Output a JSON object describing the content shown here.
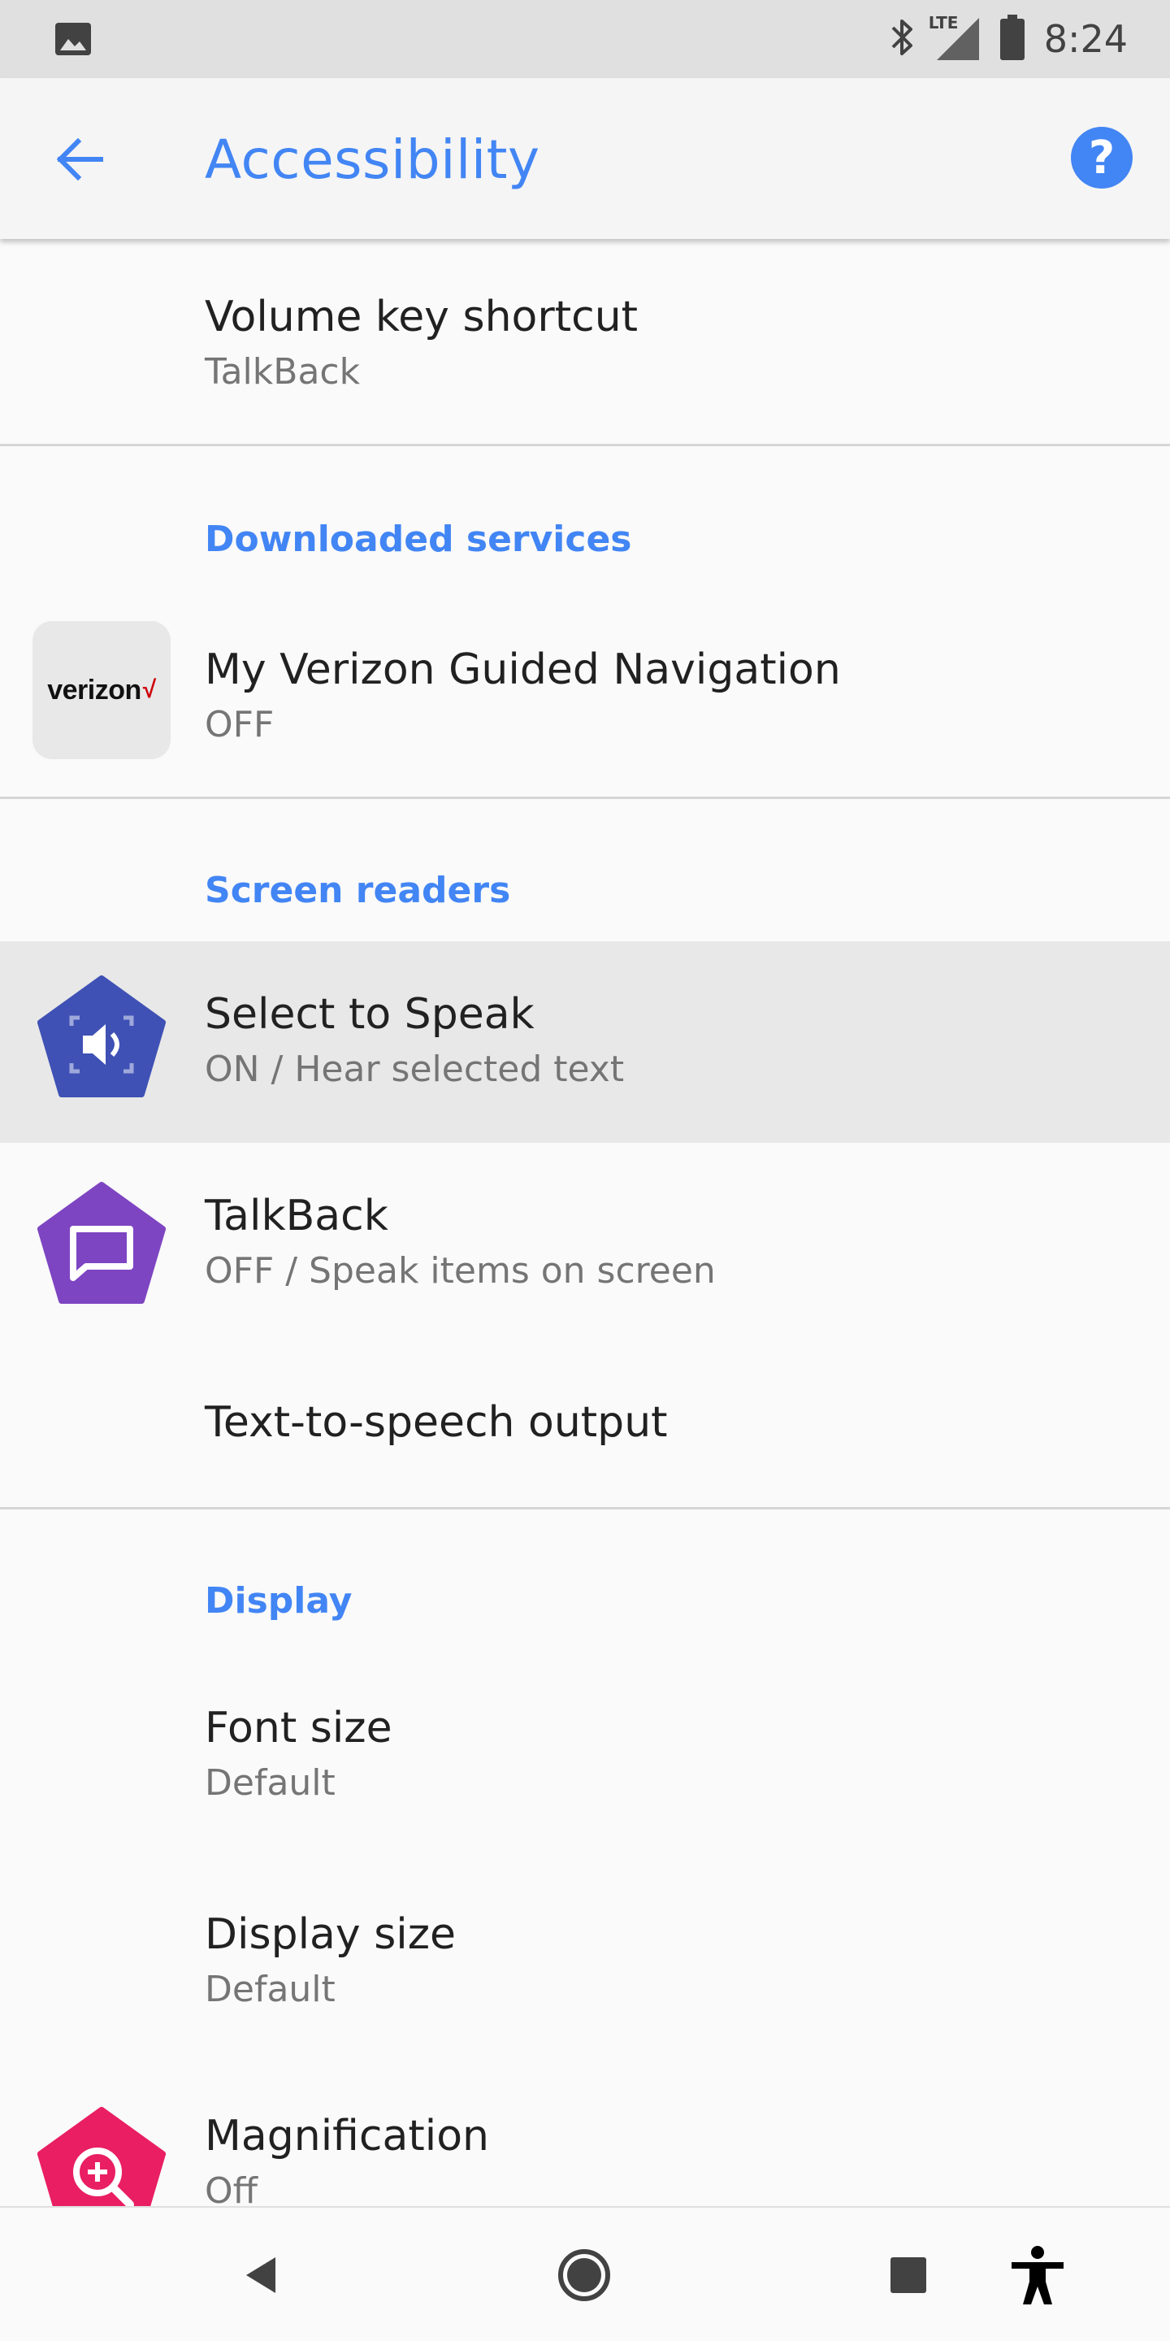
{
  "status_bar": {
    "time": "8:24",
    "network_label": "LTE",
    "icons": [
      "image-icon",
      "bluetooth-icon",
      "signal-icon",
      "battery-icon"
    ]
  },
  "app_bar": {
    "title": "Accessibility",
    "accent_color": "#4285f4",
    "help_glyph": "?"
  },
  "items": {
    "volume_key": {
      "title": "Volume key shortcut",
      "summary": "TalkBack"
    },
    "downloaded_header": "Downloaded services",
    "verizon": {
      "title": "My Verizon Guided Navigation",
      "summary": "OFF",
      "logo_text": "verizon",
      "logo_check": "√"
    },
    "screen_readers_header": "Screen readers",
    "select_to_speak": {
      "title": "Select to Speak",
      "summary": "ON / Hear selected text",
      "icon_color": "#3f51b5"
    },
    "talkback": {
      "title": "TalkBack",
      "summary": "OFF / Speak items on screen",
      "icon_color": "#7e45c2"
    },
    "tts": {
      "title": "Text-to-speech output"
    },
    "display_header": "Display",
    "font_size": {
      "title": "Font size",
      "summary": "Default"
    },
    "display_size": {
      "title": "Display size",
      "summary": "Default"
    },
    "magnification": {
      "title": "Magnification",
      "summary": "Off",
      "icon_color": "#e91e63"
    }
  },
  "nav_bar": {
    "buttons": [
      "back-icon",
      "home-icon",
      "recents-icon",
      "accessibility-icon"
    ]
  }
}
